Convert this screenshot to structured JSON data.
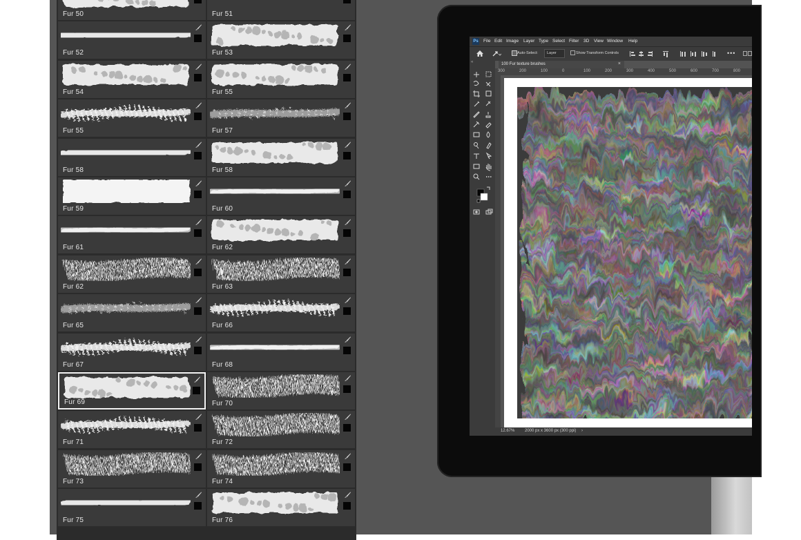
{
  "brushes": {
    "tiles": [
      {
        "label": "Fur 50",
        "style": "blob"
      },
      {
        "label": "Fur 51",
        "style": "wavy"
      },
      {
        "label": "Fur 52",
        "style": "wavy"
      },
      {
        "label": "Fur 53",
        "style": "blob"
      },
      {
        "label": "Fur 54",
        "style": "blob"
      },
      {
        "label": "Fur 55",
        "style": "blob"
      },
      {
        "label": "Fur 55",
        "style": "spiky"
      },
      {
        "label": "Fur 57",
        "style": "speckle"
      },
      {
        "label": "Fur 58",
        "style": "wavy"
      },
      {
        "label": "Fur 58",
        "style": "blob"
      },
      {
        "label": "Fur 59",
        "style": "block"
      },
      {
        "label": "Fur 60",
        "style": "smooth"
      },
      {
        "label": "Fur 61",
        "style": "smooth"
      },
      {
        "label": "Fur 62",
        "style": "blob"
      },
      {
        "label": "Fur 62",
        "style": "hair"
      },
      {
        "label": "Fur 63",
        "style": "hair"
      },
      {
        "label": "Fur 65",
        "style": "speckle"
      },
      {
        "label": "Fur 66",
        "style": "spiky"
      },
      {
        "label": "Fur 67",
        "style": "spiky"
      },
      {
        "label": "Fur 68",
        "style": "smooth"
      },
      {
        "label": "Fur 69",
        "style": "blob"
      },
      {
        "label": "Fur 70",
        "style": "hair"
      },
      {
        "label": "Fur 71",
        "style": "spiky"
      },
      {
        "label": "Fur 72",
        "style": "hair"
      },
      {
        "label": "Fur 73",
        "style": "hair"
      },
      {
        "label": "Fur 74",
        "style": "hair"
      },
      {
        "label": "Fur 75",
        "style": "wavy"
      },
      {
        "label": "Fur 76",
        "style": "blob"
      }
    ],
    "selected_index": 20
  },
  "photoshop": {
    "logo": "Ps",
    "menu": [
      "File",
      "Edit",
      "Image",
      "Layer",
      "Type",
      "Select",
      "Filter",
      "3D",
      "View",
      "Window",
      "Help"
    ],
    "options": {
      "auto_select_label": "Auto-Select:",
      "auto_select_value": "Layer",
      "transform_label": "Show Transform Controls"
    },
    "document_tab": "100 Fur texture brushes",
    "ruler_top": [
      "300",
      "200",
      "100",
      "0",
      "100",
      "200",
      "300",
      "400",
      "500",
      "600",
      "700",
      "800"
    ],
    "status": {
      "zoom": "12.67%",
      "doc_info": "2000 px x 3600 px (300 ppi)"
    }
  },
  "colors": {
    "panel_bg": "#2b2b2b",
    "tile_bg": "#3a3a3a",
    "background": "#555555",
    "ps_chrome": "#3b3b3b",
    "ps_canvas": "#535353"
  }
}
